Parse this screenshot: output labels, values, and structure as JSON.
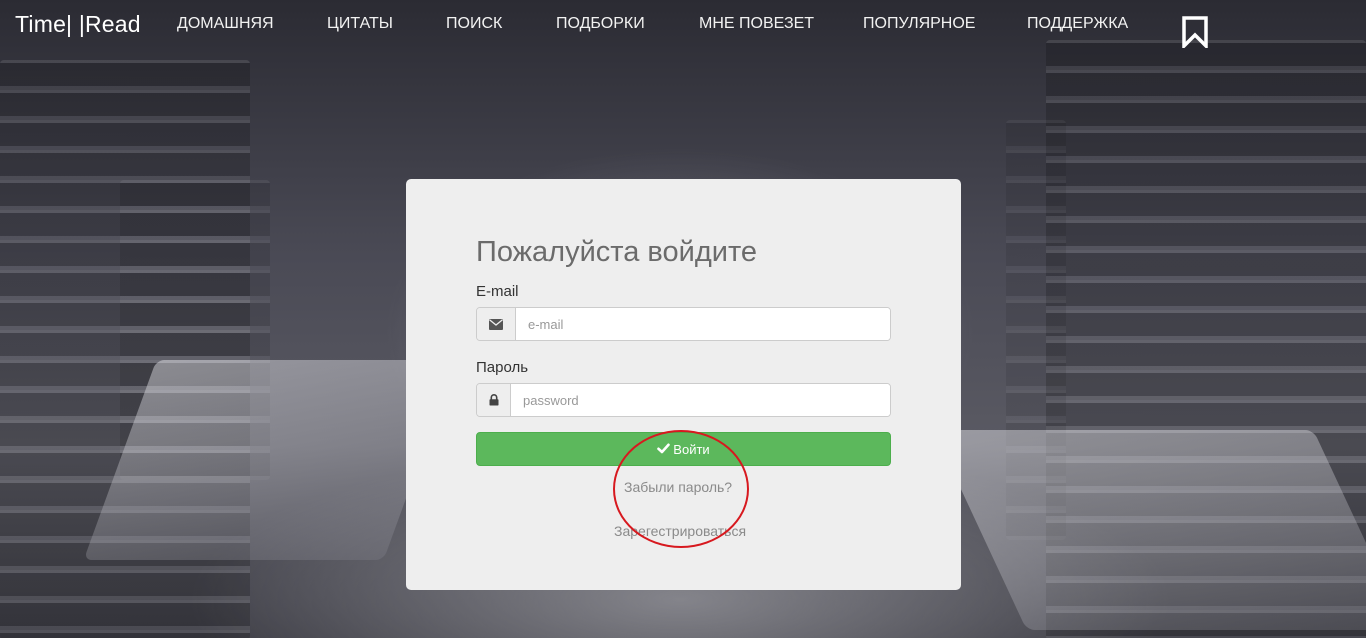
{
  "brand": "Time| |Read",
  "nav": {
    "items": [
      {
        "label": "Домашняя"
      },
      {
        "label": "Цитаты"
      },
      {
        "label": "Поиск"
      },
      {
        "label": "Подборки"
      },
      {
        "label": "Мне повезет"
      },
      {
        "label": "Популярное"
      },
      {
        "label": "Поддержка"
      }
    ],
    "bookmark_icon": "bookmark-icon"
  },
  "login": {
    "title": "Пожалуйста войдите",
    "email_label": "E-mail",
    "email_placeholder": "e-mail",
    "email_value": "",
    "email_icon": "envelope-icon",
    "password_label": "Пароль",
    "password_placeholder": "password",
    "password_value": "",
    "password_icon": "lock-icon",
    "submit_label": "Войти",
    "submit_icon": "check-icon",
    "forgot_label": "Забыли пароль?",
    "register_label": "Зарегестрироваться"
  },
  "colors": {
    "accent_green": "#5cb85c",
    "annotation_red": "#d7191f",
    "panel_bg": "#eeeeee"
  }
}
